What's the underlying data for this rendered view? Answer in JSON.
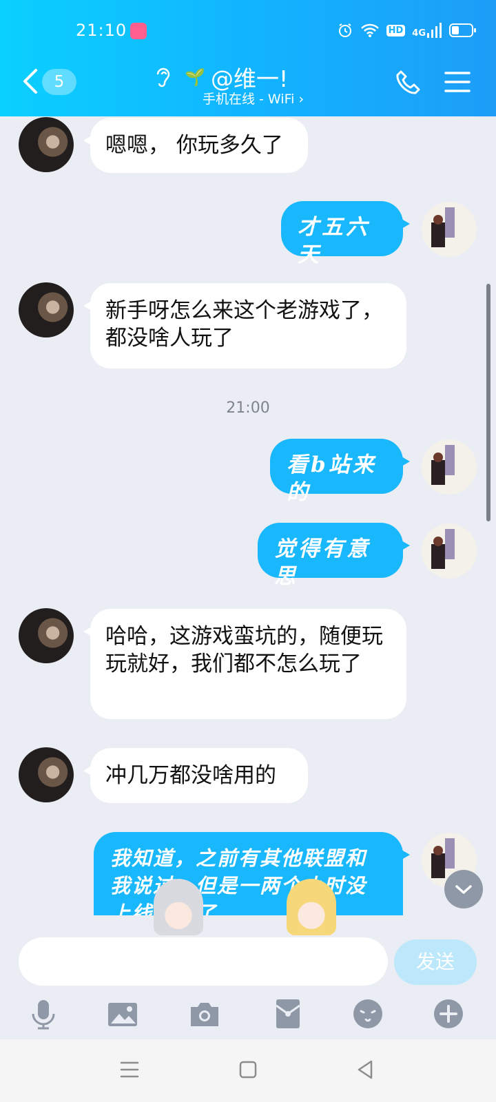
{
  "status_bar": {
    "time": "21:10",
    "icons": [
      "app-notification-icon",
      "alarm-icon",
      "wifi-icon",
      "hd-icon",
      "4g-signal-icon",
      "battery-icon"
    ],
    "hd": "HD",
    "network": "4G"
  },
  "header": {
    "unread_count": "5",
    "title": "@维一!",
    "subtitle": "手机在线 - WiFi ›",
    "icons": [
      "back-icon",
      "ear-icon",
      "sprout-icon",
      "phone-icon",
      "menu-icon"
    ]
  },
  "messages": [
    {
      "side": "in",
      "text": "嗯嗯， 你玩多久了"
    },
    {
      "side": "out",
      "text": "才五六天"
    },
    {
      "side": "in",
      "text": "新手呀怎么来这个老游戏了，都没啥人玩了"
    },
    {
      "side": "out",
      "text": "看b站来的"
    },
    {
      "side": "out",
      "text": "觉得有意思"
    },
    {
      "side": "in",
      "text": "哈哈，这游戏蛮坑的，随便玩玩就好，我们都不怎么玩了"
    },
    {
      "side": "in",
      "text": "冲几万都没啥用的"
    },
    {
      "side": "out",
      "text": "我知道，之前有其他联盟和我说过，但是一两个小时没上线就踢了"
    }
  ],
  "timestamp": "21:00",
  "input": {
    "value": "",
    "send_label": "发送"
  },
  "toolbar": [
    "microphone-icon",
    "image-icon",
    "camera-icon",
    "red-packet-icon",
    "emoji-icon",
    "plus-icon"
  ],
  "colors": {
    "header": "#13b2ff",
    "outgoing_bubble": "#19b7fb",
    "background": "#eaedf4",
    "send_button": "#bde8fb"
  }
}
